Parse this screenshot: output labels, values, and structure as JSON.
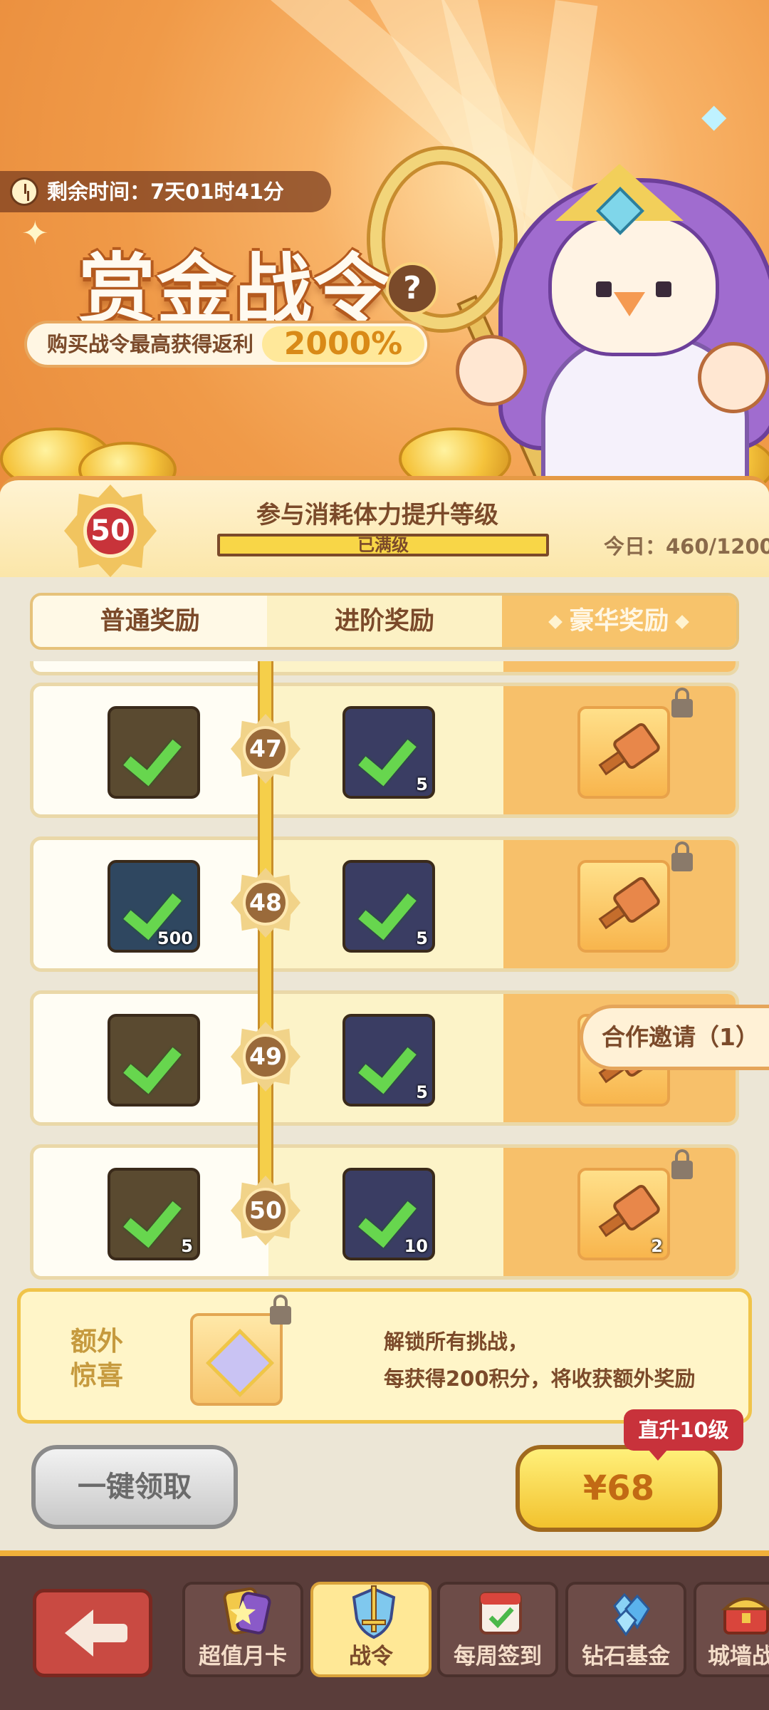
{
  "banner": {
    "timer_label": "剩余时间：7天01时41分",
    "title": "赏金战令",
    "help_glyph": "?",
    "promo_text": "购买战令最高获得返利",
    "promo_percent": "2000%"
  },
  "level": {
    "current": "50",
    "title": "参与消耗体力提升等级",
    "progress_text": "已满级",
    "progress_fraction": 1.0,
    "today": "今日：460/1200"
  },
  "tabs": [
    "普通奖励",
    "进阶奖励",
    "豪华奖励"
  ],
  "active_tab": 2,
  "rows": [
    {
      "level": "47",
      "normal": {
        "icon": "stone-icon",
        "qty": "",
        "claimed": true
      },
      "advanced": {
        "icon": "scroll-icon",
        "qty": "5",
        "claimed": true
      },
      "luxury": {
        "icon": "hammer-icon",
        "qty": "",
        "locked": true
      }
    },
    {
      "level": "48",
      "normal": {
        "icon": "coin-icon",
        "qty": "500",
        "claimed": true
      },
      "advanced": {
        "icon": "scroll-icon",
        "qty": "5",
        "claimed": true
      },
      "luxury": {
        "icon": "hammer-icon",
        "qty": "",
        "locked": true
      }
    },
    {
      "level": "49",
      "normal": {
        "icon": "stone-icon",
        "qty": "",
        "claimed": true
      },
      "advanced": {
        "icon": "scroll-icon",
        "qty": "5",
        "claimed": true
      },
      "luxury": {
        "icon": "hammer-icon",
        "qty": "",
        "locked": true
      }
    },
    {
      "level": "50",
      "normal": {
        "icon": "axe-icon",
        "qty": "5",
        "claimed": true
      },
      "advanced": {
        "icon": "scroll-icon",
        "qty": "10",
        "claimed": true
      },
      "luxury": {
        "icon": "hammer-icon",
        "qty": "2",
        "locked": true
      }
    }
  ],
  "coop_invite": "合作邀请（1）",
  "bonus": {
    "label_line1": "额外",
    "label_line2": "惊喜",
    "text_line1": "解锁所有挑战，",
    "text_line2": "每获得200积分，将收获额外奖励"
  },
  "claim_all": "一键领取",
  "buy": {
    "price": "¥68",
    "tag": "直升10级"
  },
  "nav": [
    {
      "label": "超值月卡",
      "icon": "monthly-card-icon",
      "active": false
    },
    {
      "label": "战令",
      "icon": "battle-pass-shield-icon",
      "active": true
    },
    {
      "label": "每周签到",
      "icon": "calendar-check-icon",
      "active": false
    },
    {
      "label": "钻石基金",
      "icon": "diamond-fund-icon",
      "active": false
    },
    {
      "label": "城墙战",
      "icon": "treasure-chest-icon",
      "active": false
    }
  ],
  "colors": {
    "banner": "#f09a48",
    "check": "#67d64e",
    "level_badge": "#c8333a",
    "buy_button": "#f2c22e",
    "tag": "#c8323b",
    "nav_bg": "#5a3d3a"
  }
}
